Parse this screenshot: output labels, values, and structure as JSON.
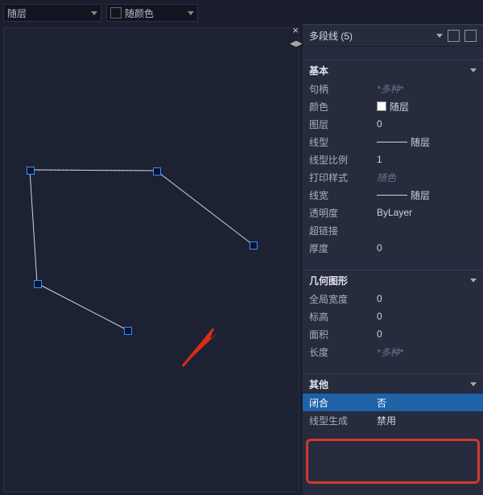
{
  "toolbar": {
    "layer": "随层",
    "color": "随颜色"
  },
  "panel": {
    "title": "多段线 (5)",
    "sections": {
      "basic": {
        "label": "基本",
        "rows": {
          "handle": {
            "k": "句柄",
            "v": "*多种*"
          },
          "color": {
            "k": "颜色",
            "v": "随层"
          },
          "layer": {
            "k": "图层",
            "v": "0"
          },
          "linetype": {
            "k": "线型",
            "v": "随层"
          },
          "ltscale": {
            "k": "线型比例",
            "v": "1"
          },
          "plotstyle": {
            "k": "打印样式",
            "v": "随色"
          },
          "lineweight": {
            "k": "线宽",
            "v": "随层"
          },
          "transparency": {
            "k": "透明度",
            "v": "ByLayer"
          },
          "hyperlink": {
            "k": "超链接",
            "v": ""
          },
          "thickness": {
            "k": "厚度",
            "v": "0"
          }
        }
      },
      "geom": {
        "label": "几何图形",
        "rows": {
          "globalwidth": {
            "k": "全局宽度",
            "v": "0"
          },
          "elev": {
            "k": "标高",
            "v": "0"
          },
          "area": {
            "k": "面积",
            "v": "0"
          },
          "length": {
            "k": "长度",
            "v": "*多种*"
          }
        }
      },
      "other": {
        "label": "其他",
        "rows": {
          "closed": {
            "k": "闭合",
            "v": "否"
          },
          "ltgen": {
            "k": "线型生成",
            "v": "禁用"
          }
        }
      }
    }
  }
}
